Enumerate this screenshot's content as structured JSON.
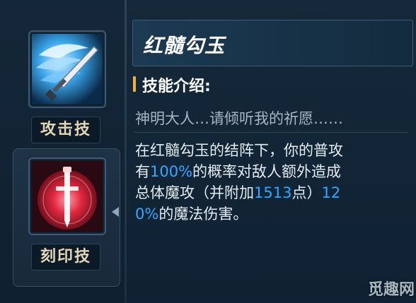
{
  "skills": [
    {
      "label": "攻击技",
      "icon": "winged-sword-icon",
      "active": false
    },
    {
      "label": "刻印技",
      "icon": "crimson-sword-emblem-icon",
      "active": true
    }
  ],
  "detail": {
    "title": "红髓勾玉",
    "intro_heading": "技能介绍:",
    "flavor_text": "神明大人…请倾听我的祈愿……",
    "desc": {
      "l1": "在红髓勾玉的结阵下，你的普攻",
      "l2a": "有",
      "l2b": "100%",
      "l2c": "的概率对敌人额外造成",
      "l3a": "总体魔攻（并附加",
      "l3b": "1513",
      "l3c": "点）",
      "l3d": "12",
      "l4a": "0%",
      "l4b": "的魔法伤害。"
    }
  },
  "watermark": "觅趣网",
  "colors": {
    "accent": "#f0b23a",
    "highlight": "#35a7ff",
    "label_gold": "#e4d7b8"
  }
}
